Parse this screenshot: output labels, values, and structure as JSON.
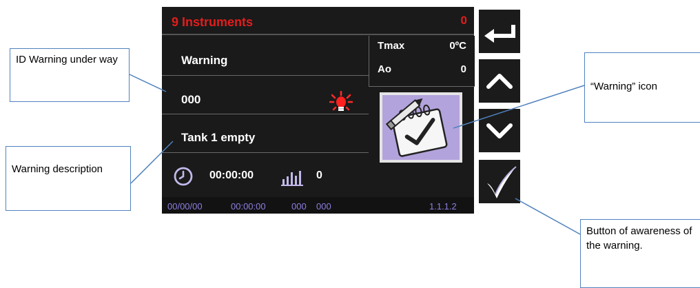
{
  "device": {
    "header_title": "9 Instruments",
    "header_count": "0",
    "warning_label": "Warning",
    "id_value": "000",
    "description": "Tank 1 empty",
    "tmax_label": "Tmax",
    "tmax_value": "0ºC",
    "ao_label": "Ao",
    "ao_value": "0",
    "timer_value": "00:00:00",
    "counter_value": "0",
    "footer": {
      "date": "00/00/00",
      "time": "00:00:00",
      "code1": "000",
      "code2": "000",
      "version": "1.1.1.2"
    },
    "buttons": [
      "back-arrow-icon",
      "arrow-up-icon",
      "arrow-down-icon",
      "checkmark-icon"
    ],
    "colors": {
      "header": "#e21d1d",
      "footer_text": "#8d7fe1",
      "icon_bg": "#b3a3dc",
      "accent": "#c2b8ea"
    }
  },
  "callouts": {
    "id_warning": "ID Warning under way",
    "warning_description": "Warning description",
    "warning_icon": "“Warning” icon",
    "awareness_button": "Button of awareness of the warning."
  }
}
